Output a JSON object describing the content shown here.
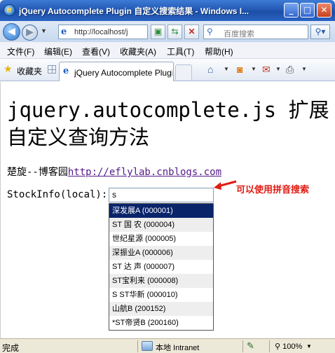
{
  "window": {
    "title": "jQuery Autocomplete Plugin 自定义搜索结果 - Windows I...",
    "minimize": "0",
    "maximize": "1",
    "close": "r"
  },
  "nav": {
    "address": "http://localhost/j",
    "search_placeholder": "百度搜索"
  },
  "menu": [
    "文件(F)",
    "编辑(E)",
    "查看(V)",
    "收藏夹(A)",
    "工具(T)",
    "帮助(H)"
  ],
  "favorites": {
    "label": "收藏夹"
  },
  "tab": {
    "title": "jQuery Autocomplete Plugi..."
  },
  "page": {
    "heading": "jquery.autocomplete.js 扩展自定义查询方法",
    "blog_prefix": "楚旋--博客园",
    "blog_link": "http://eflylab.cnblogs.com",
    "stock_label": "StockInfo(local):",
    "stock_value": "s",
    "hint": "可以使用拼音搜索",
    "suggestions": [
      "深发展A (000001)",
      "ST 国 农 (000004)",
      "世纪星源 (000005)",
      "深振业A (000006)",
      "ST 达 声 (000007)",
      "ST宝利来 (000008)",
      "S ST华新 (000010)",
      "山航B (200152)",
      "*ST帝贤B (200160)"
    ],
    "selected_index": 0
  },
  "status": {
    "text": "完成",
    "zone": "本地 Intranet",
    "zoom": "100%"
  },
  "colors": {
    "title_bar": "#2459b5",
    "hint_red": "#e01b12",
    "selection": "#0a246a",
    "link": "#551a8b"
  }
}
